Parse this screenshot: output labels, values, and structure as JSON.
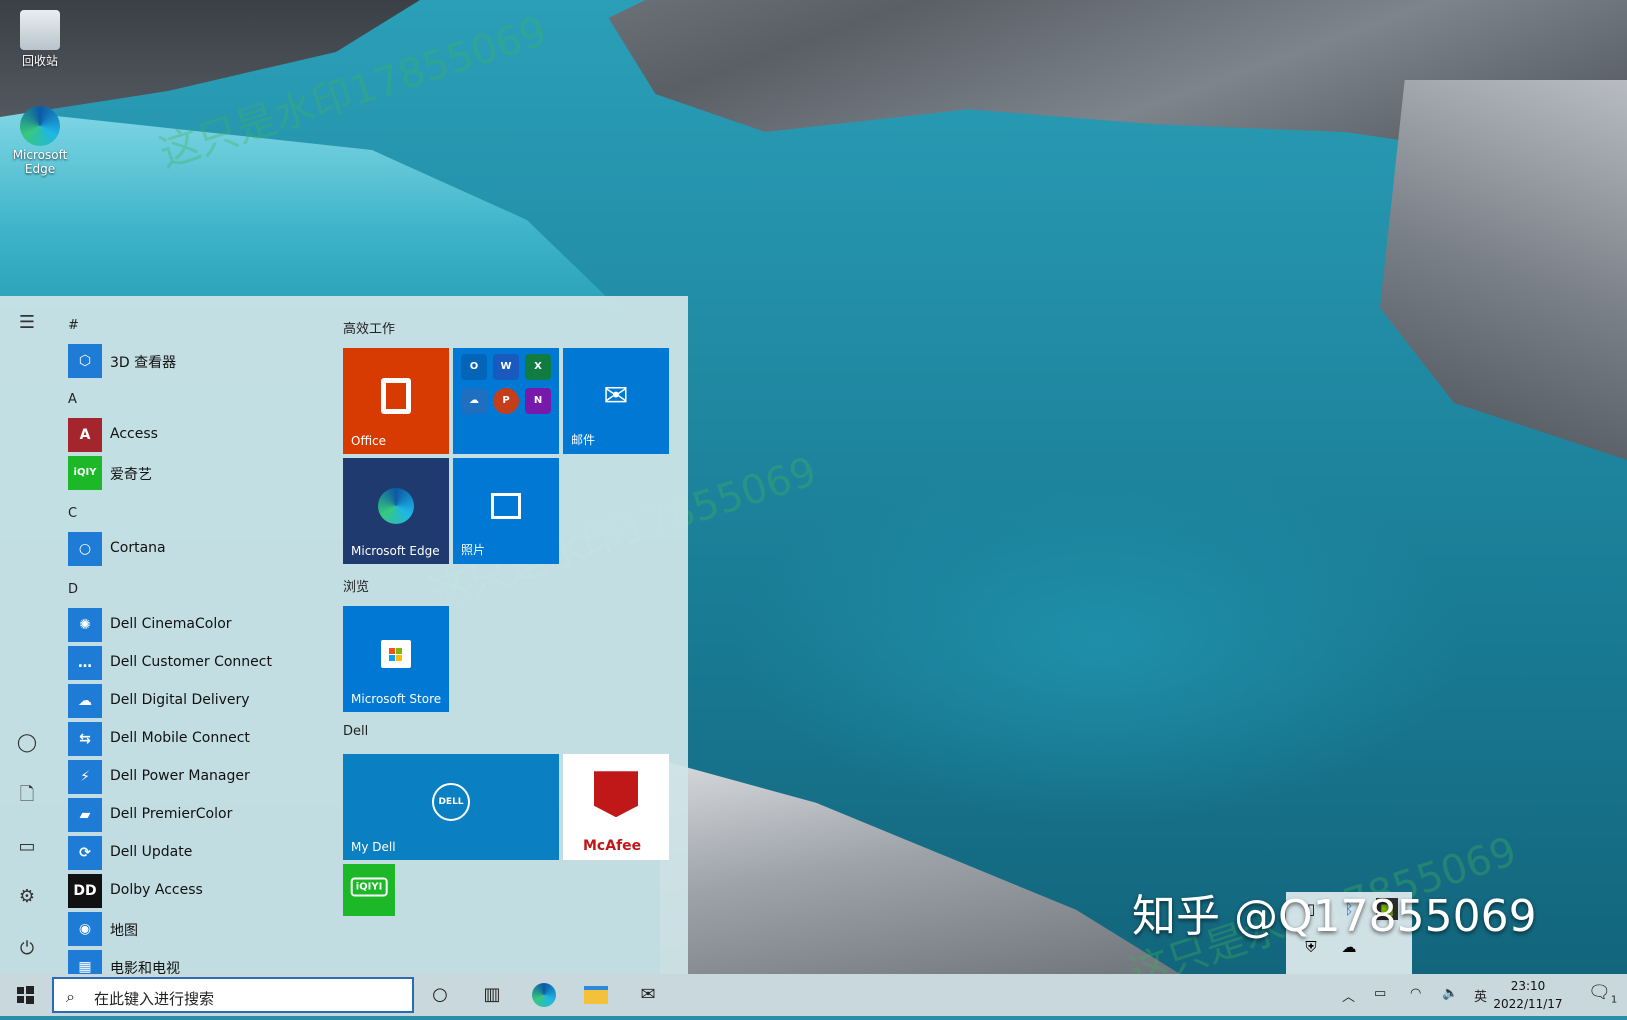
{
  "desktop": {
    "icons": [
      {
        "label": "回收站"
      },
      {
        "label": "Microsoft Edge"
      }
    ],
    "watermark_text": "这只是水印17855069",
    "brand_text": "知乎 @Q17855069"
  },
  "start_menu": {
    "rail_icons": [
      "menu-icon",
      "user-icon",
      "document-icon",
      "pictures-icon",
      "settings-icon",
      "power-icon"
    ],
    "groups": [
      {
        "letter": "#",
        "apps": [
          {
            "label": "3D 查看器",
            "icon": "cube-icon",
            "color": "#1e7bd6"
          }
        ]
      },
      {
        "letter": "A",
        "apps": [
          {
            "label": "Access",
            "icon": "access-icon",
            "color": "#a4262c"
          },
          {
            "label": "爱奇艺",
            "icon": "iqiyi-icon",
            "color": "#1cb828"
          }
        ]
      },
      {
        "letter": "C",
        "apps": [
          {
            "label": "Cortana",
            "icon": "cortana-icon",
            "color": "#1e7bd6"
          }
        ]
      },
      {
        "letter": "D",
        "apps": [
          {
            "label": "Dell CinemaColor",
            "icon": "cinemacolor-icon",
            "color": "#1e7bd6"
          },
          {
            "label": "Dell Customer Connect",
            "icon": "chat-icon",
            "color": "#1e7bd6"
          },
          {
            "label": "Dell Digital Delivery",
            "icon": "cloud-download-icon",
            "color": "#1e7bd6"
          },
          {
            "label": "Dell Mobile Connect",
            "icon": "mobile-connect-icon",
            "color": "#1e7bd6"
          },
          {
            "label": "Dell Power Manager",
            "icon": "power-plug-icon",
            "color": "#1e7bd6"
          },
          {
            "label": "Dell PremierColor",
            "icon": "premiercolor-icon",
            "color": "#1e7bd6"
          },
          {
            "label": "Dell Update",
            "icon": "dell-update-icon",
            "color": "#1e7bd6"
          },
          {
            "label": "Dolby Access",
            "icon": "dolby-icon",
            "color": "#111111"
          },
          {
            "label": "地图",
            "icon": "map-pin-icon",
            "color": "#1e7bd6"
          },
          {
            "label": "电影和电视",
            "icon": "film-icon",
            "color": "#1e7bd6"
          }
        ]
      }
    ],
    "sections": {
      "work_title": "高效工作",
      "browse_title": "浏览",
      "dell_title": "Dell"
    },
    "tiles": {
      "office": {
        "label": "Office",
        "color": "#d83b01"
      },
      "office_apps": [
        "O",
        "W",
        "X",
        "",
        "P",
        "N"
      ],
      "mail": {
        "label": "邮件",
        "color": "#0078d4"
      },
      "edge": {
        "label": "Microsoft Edge",
        "color": "#1f3a6e"
      },
      "photos": {
        "label": "照片",
        "color": "#0078d4"
      },
      "store": {
        "label": "Microsoft Store",
        "color": "#0078d4"
      },
      "mydell": {
        "label": "My Dell",
        "color": "#0a7fc2",
        "logo": "DELL"
      },
      "mcafee": {
        "label": "McAfee",
        "color": "#ffffff"
      },
      "iqiyi": {
        "label": "iQIYI",
        "color": "#1cb828"
      }
    }
  },
  "taskbar": {
    "search_placeholder": "在此键入进行搜索",
    "ime": "英",
    "time": "23:10",
    "date": "2022/11/17",
    "notification_count": "1"
  }
}
